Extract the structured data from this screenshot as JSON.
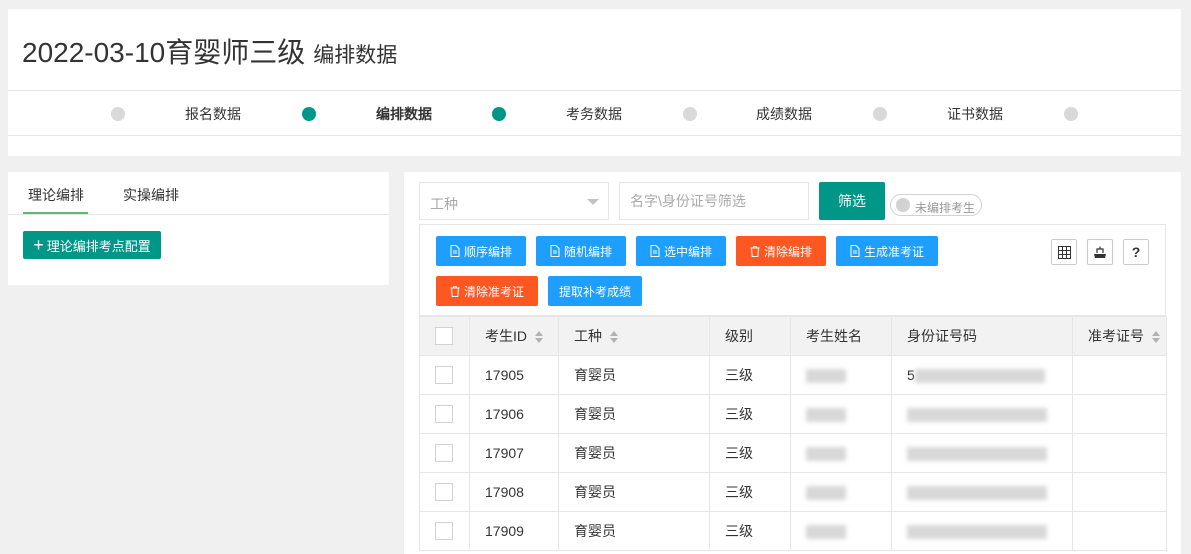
{
  "header": {
    "title": "2022-03-10育婴师三级",
    "subtitle": "编排数据",
    "steps": [
      {
        "label": "报名数据"
      },
      {
        "label": "编排数据"
      },
      {
        "label": "考务数据"
      },
      {
        "label": "成绩数据"
      },
      {
        "label": "证书数据"
      }
    ]
  },
  "left_panel": {
    "tabs": [
      "理论编排",
      "实操编排"
    ],
    "active_tab": "理论编排",
    "config_button": "理论编排考点配置"
  },
  "filters": {
    "select_placeholder": "工种",
    "search_placeholder": "名字\\身份证号筛选",
    "filter_button": "筛选",
    "toggle_label": "未编排考生"
  },
  "toolbar": {
    "buttons": [
      "顺序编排",
      "随机编排",
      "选中编排",
      "清除编排",
      "生成准考证",
      "清除准考证",
      "提取补考成绩"
    ],
    "help_label": "?"
  },
  "table": {
    "columns": [
      "考生ID",
      "工种",
      "级别",
      "考生姓名",
      "身份证号码",
      "准考证号"
    ],
    "rows": [
      {
        "id": "17905",
        "trade": "育婴员",
        "level": "三级",
        "name": "",
        "idcard": "5",
        "ticket": ""
      },
      {
        "id": "17906",
        "trade": "育婴员",
        "level": "三级",
        "name": "",
        "idcard": "",
        "ticket": ""
      },
      {
        "id": "17907",
        "trade": "育婴员",
        "level": "三级",
        "name": "",
        "idcard": "",
        "ticket": ""
      },
      {
        "id": "17908",
        "trade": "育婴员",
        "level": "三级",
        "name": "",
        "idcard": "",
        "ticket": ""
      },
      {
        "id": "17909",
        "trade": "育婴员",
        "level": "三级",
        "name": "",
        "idcard": "",
        "ticket": ""
      }
    ]
  },
  "colors": {
    "primary": "#009688",
    "blue": "#1e9fff",
    "red": "#ff5722",
    "tab_underline": "#5fb878"
  }
}
